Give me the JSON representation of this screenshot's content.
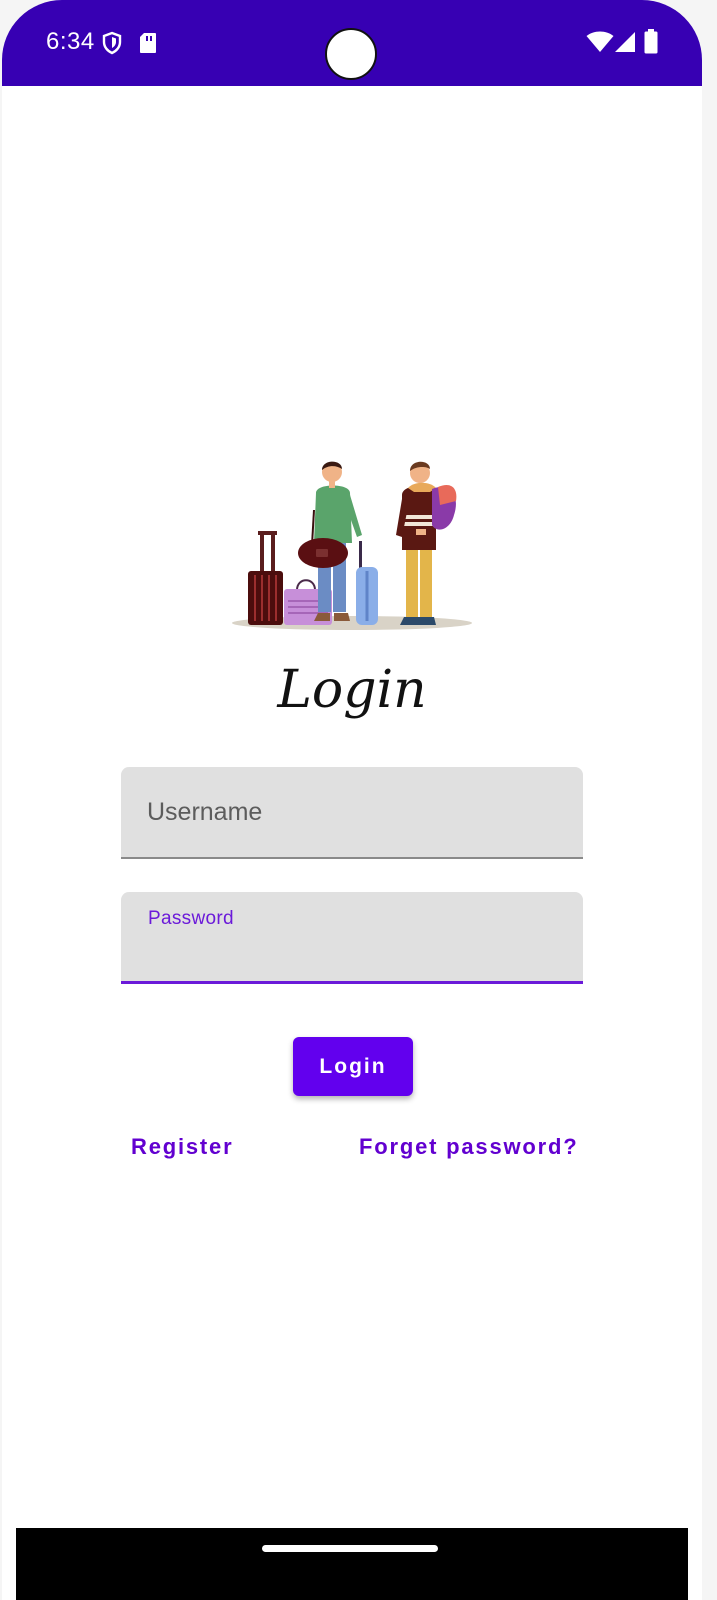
{
  "status_bar": {
    "time": "6:34",
    "icons": [
      "shield-icon",
      "sd-card-icon",
      "wifi-icon",
      "signal-icon",
      "battery-icon"
    ],
    "color": "#3700b3"
  },
  "screen": {
    "title": "Login",
    "username": {
      "placeholder": "Username",
      "value": ""
    },
    "password": {
      "label": "Password",
      "value": ""
    },
    "login_button": "Login",
    "register_link": "Register",
    "forget_link": "Forget password?",
    "accent_color": "#6200ee"
  }
}
